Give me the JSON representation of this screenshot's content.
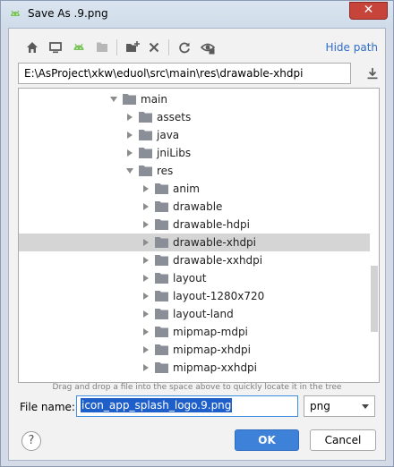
{
  "window": {
    "title": "Save As .9.png",
    "close_glyph": "✕"
  },
  "toolbar": {
    "icons": [
      "home-icon",
      "desktop-icon",
      "android-icon",
      "module-icon",
      "new-folder-icon",
      "delete-icon",
      "refresh-icon",
      "show-hidden-icon"
    ],
    "hide_path_label": "Hide path"
  },
  "path": {
    "value": "E:\\AsProject\\xkw\\eduol\\src\\main\\res\\drawable-xhdpi"
  },
  "tree": {
    "items": [
      {
        "label": "main",
        "depth": 0,
        "expanded": true
      },
      {
        "label": "assets",
        "depth": 1,
        "expanded": false
      },
      {
        "label": "java",
        "depth": 1,
        "expanded": false
      },
      {
        "label": "jniLibs",
        "depth": 1,
        "expanded": false
      },
      {
        "label": "res",
        "depth": 1,
        "expanded": true
      },
      {
        "label": "anim",
        "depth": 2,
        "expanded": false
      },
      {
        "label": "drawable",
        "depth": 2,
        "expanded": false
      },
      {
        "label": "drawable-hdpi",
        "depth": 2,
        "expanded": false
      },
      {
        "label": "drawable-xhdpi",
        "depth": 2,
        "expanded": false,
        "selected": true
      },
      {
        "label": "drawable-xxhdpi",
        "depth": 2,
        "expanded": false
      },
      {
        "label": "layout",
        "depth": 2,
        "expanded": false
      },
      {
        "label": "layout-1280x720",
        "depth": 2,
        "expanded": false
      },
      {
        "label": "layout-land",
        "depth": 2,
        "expanded": false
      },
      {
        "label": "mipmap-mdpi",
        "depth": 2,
        "expanded": false
      },
      {
        "label": "mipmap-xhdpi",
        "depth": 2,
        "expanded": false
      },
      {
        "label": "mipmap-xxhdpi",
        "depth": 2,
        "expanded": false
      }
    ]
  },
  "hint": "Drag and drop a file into the space above to quickly locate it in the tree",
  "file": {
    "label": "File name:",
    "value": "icon_app_splash_logo.9.png",
    "type_value": "png"
  },
  "buttons": {
    "help": "?",
    "ok": "OK",
    "cancel": "Cancel"
  },
  "colors": {
    "accent": "#3d82d8",
    "link": "#2f6cc8",
    "android": "#78c257",
    "folder": "#8a8f97"
  }
}
